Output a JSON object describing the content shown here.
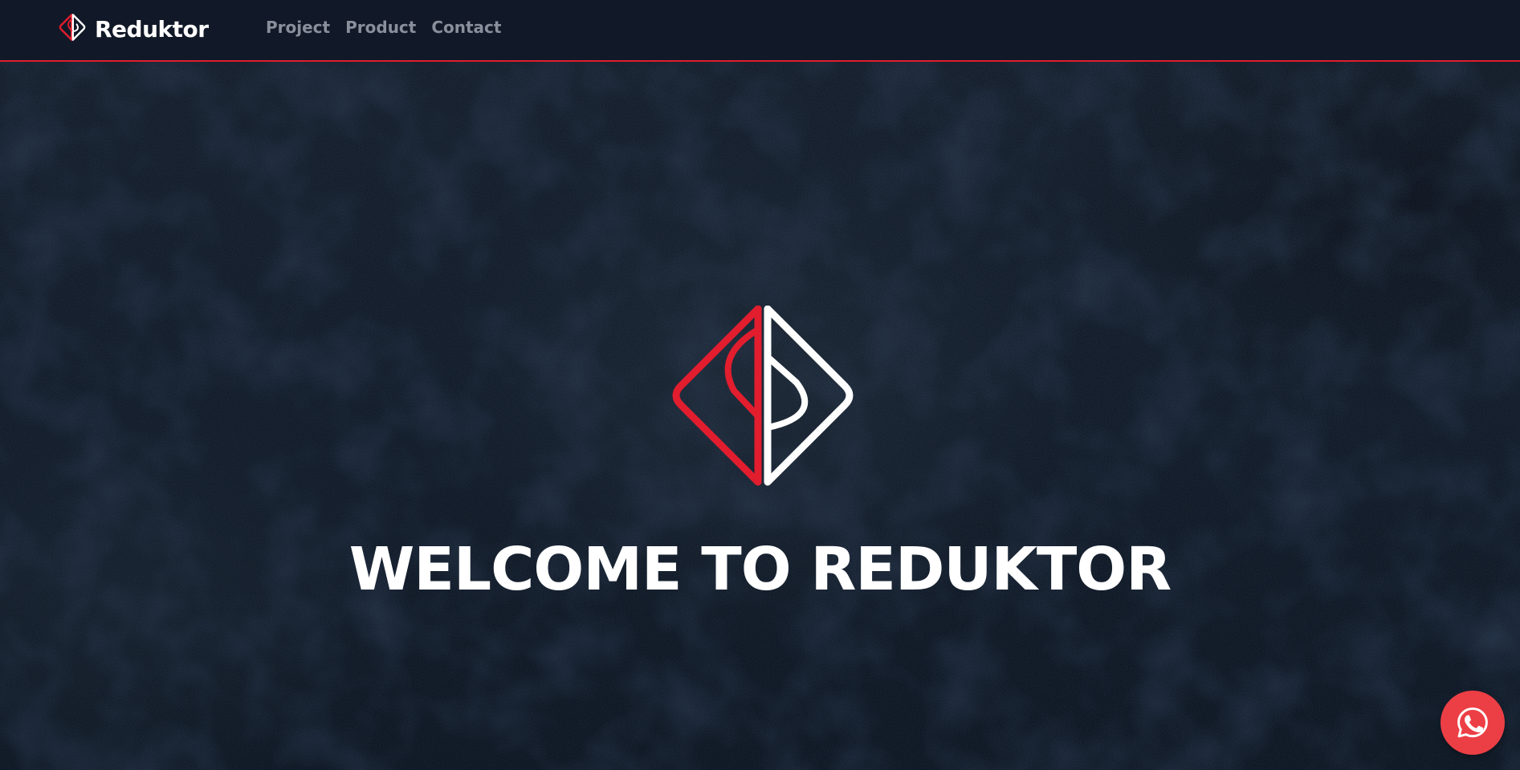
{
  "brand": {
    "name": "Reduktor",
    "logo_icon": "reduktor-diamond-logo-icon"
  },
  "nav": {
    "items": [
      {
        "label": "Project"
      },
      {
        "label": "Product"
      },
      {
        "label": "Contact"
      }
    ]
  },
  "hero": {
    "logo_icon": "reduktor-diamond-logo-icon",
    "title": "WELCOME TO REDUKTOR"
  },
  "chat": {
    "icon": "whatsapp-icon"
  },
  "colors": {
    "accent": "#e11d2e",
    "navbar_bg": "#111827",
    "hero_bg": "#0e1826",
    "nav_text": "#8a8f9c",
    "chat_button": "#ec3f45",
    "text_primary": "#ffffff"
  }
}
